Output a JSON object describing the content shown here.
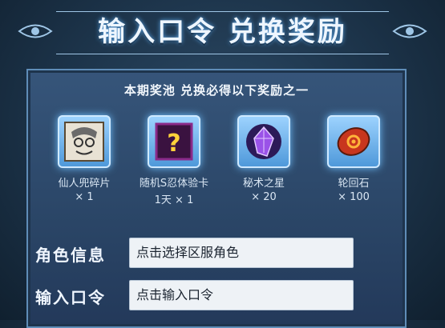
{
  "header": {
    "title": "输入口令  兑换奖励"
  },
  "pool": {
    "title": "本期奖池 兑换必得以下奖励之一"
  },
  "rewards": [
    {
      "name": "仙人兜碎片",
      "qty": "× 1",
      "icon": "character-portrait-icon"
    },
    {
      "name": "随机S忍体验卡",
      "qty": "1天 × 1",
      "icon": "mystery-card-icon"
    },
    {
      "name": "秘术之星",
      "qty": "× 20",
      "icon": "purple-gem-icon"
    },
    {
      "name": "轮回石",
      "qty": "× 100",
      "icon": "red-stone-icon"
    }
  ],
  "form": {
    "role_label": "角色信息",
    "role_placeholder": "点击选择区服角色",
    "code_label": "输入口令",
    "code_placeholder": "点击输入口令"
  }
}
